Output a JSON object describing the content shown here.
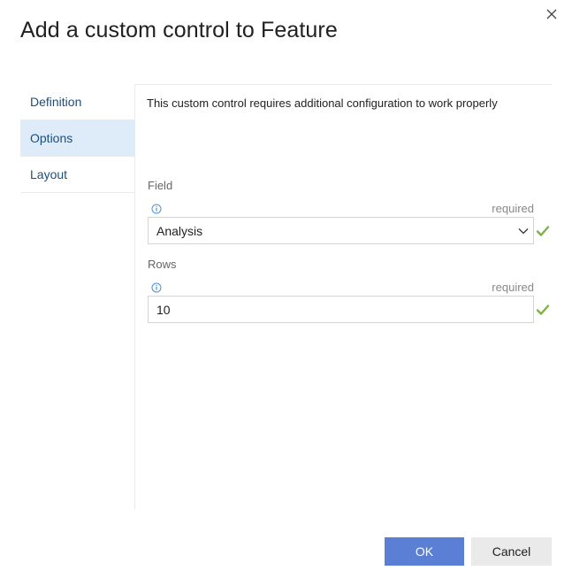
{
  "dialog": {
    "title": "Add a custom control to Feature",
    "close_icon": "close-icon"
  },
  "tabs": [
    {
      "label": "Definition",
      "selected": false
    },
    {
      "label": "Options",
      "selected": true
    },
    {
      "label": "Layout",
      "selected": false
    }
  ],
  "main": {
    "message": "This custom control requires additional configuration to work properly",
    "fields": [
      {
        "label": "Field",
        "required_text": "required",
        "value": "Analysis",
        "type": "dropdown",
        "valid": true
      },
      {
        "label": "Rows",
        "required_text": "required",
        "value": "10",
        "type": "text",
        "valid": true
      }
    ]
  },
  "footer": {
    "ok_label": "OK",
    "cancel_label": "Cancel"
  },
  "colors": {
    "primary": "#5c7fd6",
    "selected_tab_bg": "#deecf9",
    "valid_check": "#7cb342",
    "link_text": "#1e4e7c"
  }
}
